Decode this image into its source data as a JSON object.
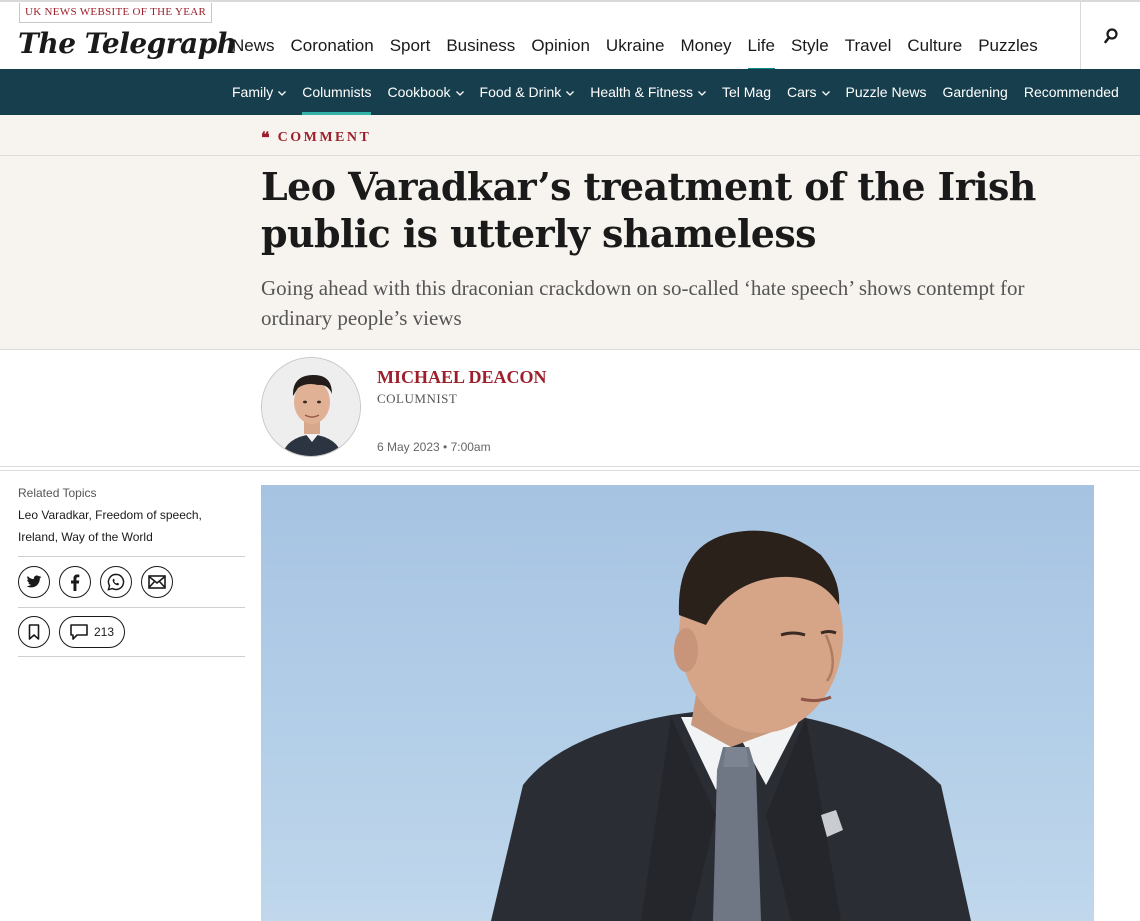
{
  "masthead": {
    "award": "UK NEWS WEBSITE OF THE YEAR",
    "logo": "The Telegraph",
    "search_icon": "search-icon"
  },
  "primary_nav": [
    {
      "label": "News"
    },
    {
      "label": "Coronation"
    },
    {
      "label": "Sport"
    },
    {
      "label": "Business"
    },
    {
      "label": "Opinion"
    },
    {
      "label": "Ukraine"
    },
    {
      "label": "Money"
    },
    {
      "label": "Life",
      "active": true
    },
    {
      "label": "Style"
    },
    {
      "label": "Travel"
    },
    {
      "label": "Culture"
    },
    {
      "label": "Puzzles"
    }
  ],
  "sub_nav": [
    {
      "label": "Family",
      "dropdown": true
    },
    {
      "label": "Columnists",
      "active": true
    },
    {
      "label": "Cookbook",
      "dropdown": true
    },
    {
      "label": "Food & Drink",
      "dropdown": true
    },
    {
      "label": "Health & Fitness",
      "dropdown": true
    },
    {
      "label": "Tel Mag"
    },
    {
      "label": "Cars",
      "dropdown": true
    },
    {
      "label": "Puzzle News"
    },
    {
      "label": "Gardening"
    },
    {
      "label": "Recommended"
    }
  ],
  "article": {
    "kicker": "COMMENT",
    "headline": "Leo Varadkar’s treatment of the Irish public is utterly shameless",
    "standfirst": "Going ahead with this draconian crackdown on so-called ‘hate speech’ shows contempt for ordinary people’s views",
    "author": "MICHAEL DEACON",
    "author_role": "COLUMNIST",
    "date": "6 May 2023 • 7:00am"
  },
  "sidebar": {
    "related_label": "Related Topics",
    "related_topics": [
      "Leo Varadkar,",
      "Freedom of speech,",
      "Ireland,",
      "Way of the World"
    ],
    "share_icons": [
      "twitter-icon",
      "facebook-icon",
      "whatsapp-icon",
      "email-icon"
    ],
    "comment_count": "213"
  },
  "colors": {
    "brand_red": "#9c1f2b",
    "subnav_bg": "#173e4c",
    "accent_teal": "#0a8a87",
    "header_bg": "#f7f4ef"
  }
}
